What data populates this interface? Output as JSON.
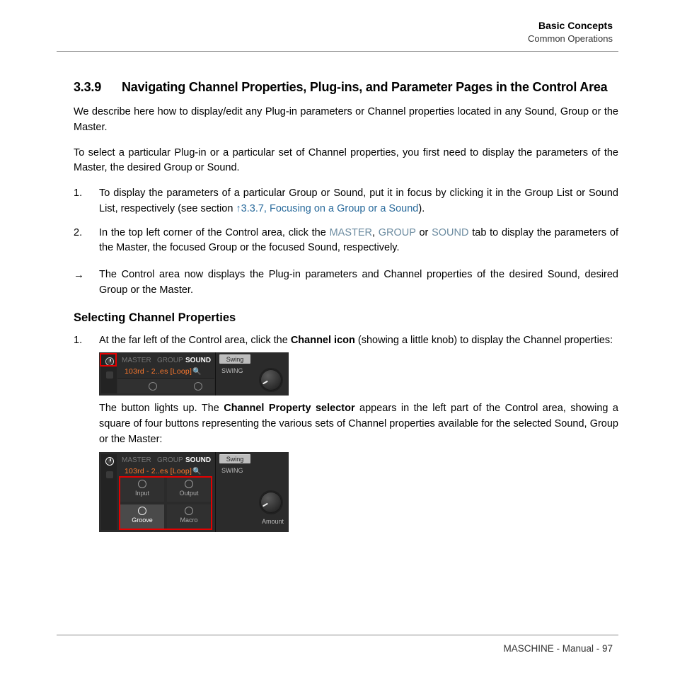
{
  "header": {
    "title": "Basic Concepts",
    "subtitle": "Common Operations"
  },
  "section": {
    "number": "3.3.9",
    "title": "Navigating Channel Properties, Plug-ins, and Parameter Pages in the Control Area",
    "p1": "We describe here how to display/edit any Plug-in parameters or Channel properties located in any Sound, Group or the Master.",
    "p2": "To select a particular Plug-in or a particular set of Channel properties, you first need to display the parameters of the Master, the desired Group or Sound.",
    "ol1": {
      "i1a": "To display the parameters of a particular Group or Sound, put it in focus by clicking it in the Group List or Sound List, respectively (see section ",
      "i1link": "↑3.3.7, Focusing on a Group or a Sound",
      "i1b": ").",
      "i2a": "In the top left corner of the Control area, click the ",
      "i2m": "MASTER",
      "i2sep1": ", ",
      "i2g": "GROUP",
      "i2sep2": " or ",
      "i2s": "SOUND",
      "i2b": " tab to display the parameters of the Master, the focused Group or the focused Sound, respectively."
    },
    "arrow": "The Control area now displays the Plug-in parameters and Channel properties of the desired Sound, desired Group or the Master.",
    "sub": "Selecting Channel Properties",
    "ol2": {
      "i1a": "At the far left of the Control area, click the ",
      "i1bold": "Channel icon",
      "i1b": " (showing a little knob) to display the Channel properties:",
      "i1post_a": "The button lights up. The ",
      "i1post_bold": "Channel Property selector",
      "i1post_b": " appears in the left part of the Control area, showing a square of four buttons representing the various sets of Channel properties available for the selected Sound, Group or the Master:"
    }
  },
  "ui": {
    "tabs": {
      "master": "MASTER",
      "group": "GROUP",
      "sound": "SOUND"
    },
    "loop": "103rd - 2..es [Loop]",
    "swing_btn": "Swing",
    "swing_label": "SWING",
    "amount": "Amount",
    "grid": {
      "tl": "Input",
      "tr": "Output",
      "bl": "Groove",
      "br": "Macro"
    }
  },
  "footer": "MASCHINE - Manual - 97"
}
